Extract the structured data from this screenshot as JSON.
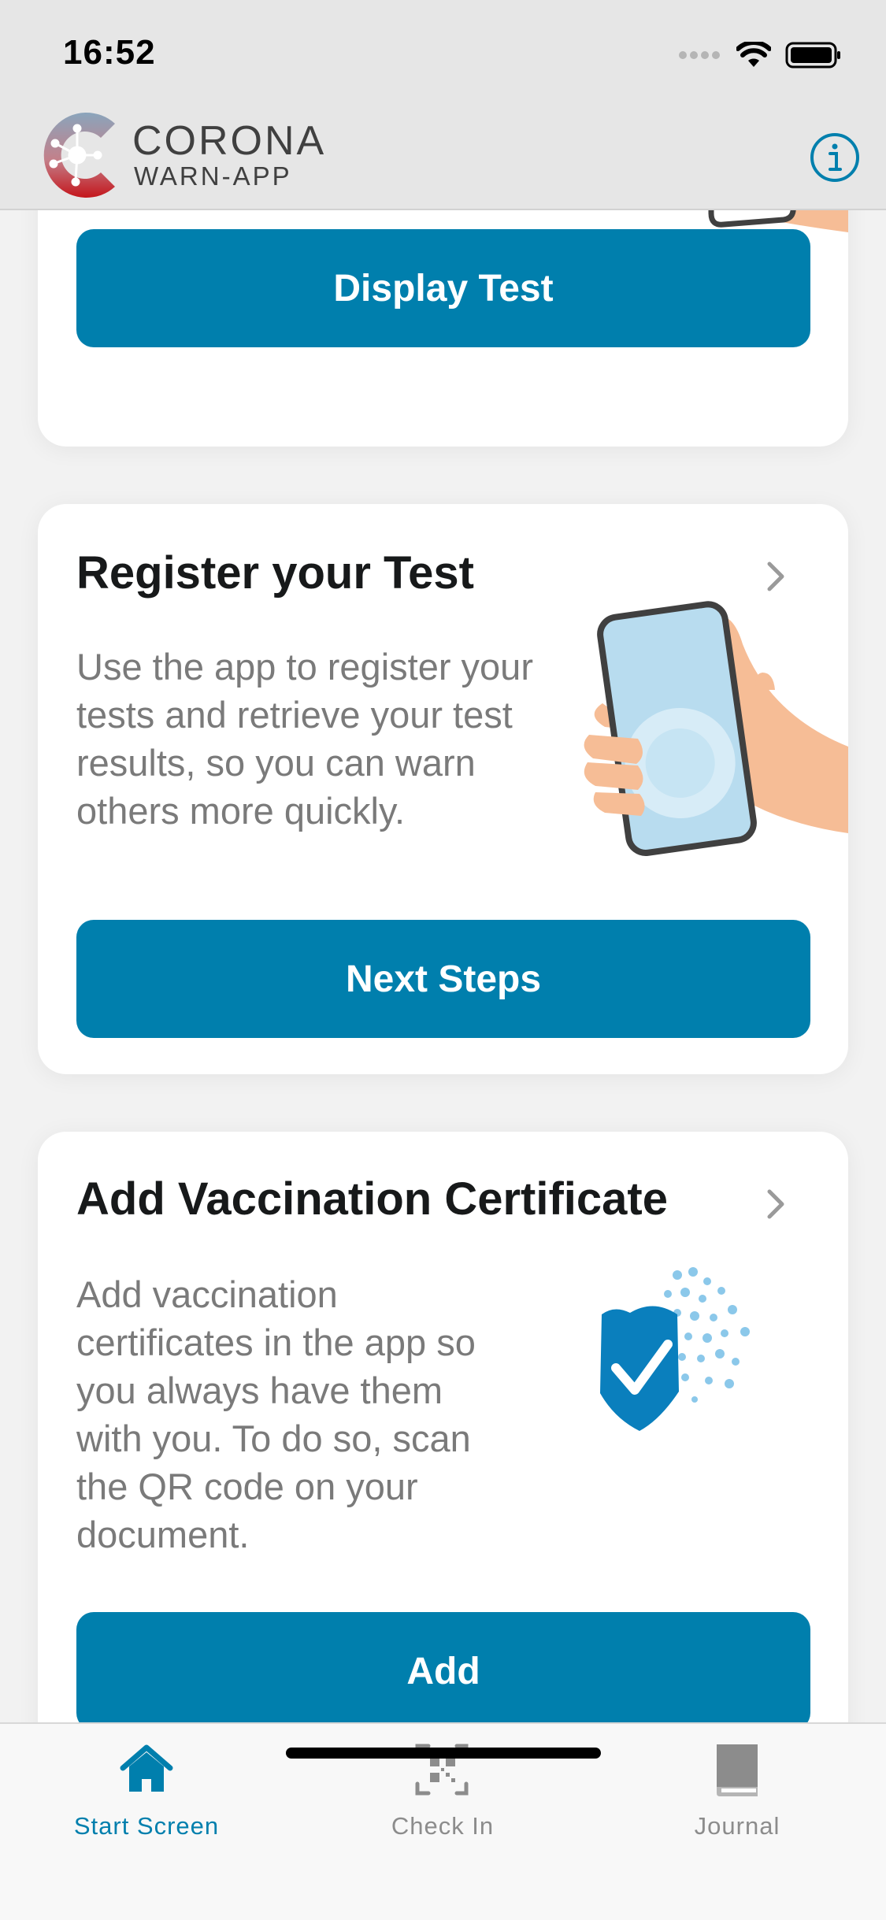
{
  "status_bar": {
    "time": "16:52"
  },
  "header": {
    "brand_line1": "CORONA",
    "brand_line2": "WARN-APP",
    "info_icon": "info-circle-icon"
  },
  "cards": {
    "test": {
      "button_label": "Display Test"
    },
    "register": {
      "title": "Register your Test",
      "body": "Use the app to register your tests and retrieve your test results, so you can warn others more quickly.",
      "button_label": "Next Steps"
    },
    "vaccination": {
      "title": "Add Vaccination Certificate",
      "body": "Add vaccination certificates in the app so you always have them with you. To do so, scan the QR code on your document.",
      "button_label": "Add"
    }
  },
  "tab_bar": {
    "tabs": [
      {
        "label": "Start Screen",
        "icon": "home-icon",
        "active": true
      },
      {
        "label": "Check In",
        "icon": "qr-scan-icon",
        "active": false
      },
      {
        "label": "Journal",
        "icon": "book-icon",
        "active": false
      }
    ]
  },
  "colors": {
    "accent": "#007fad",
    "card_background": "#ffffff",
    "background": "#f2f2f2",
    "text_secondary": "#7a7a7a"
  }
}
